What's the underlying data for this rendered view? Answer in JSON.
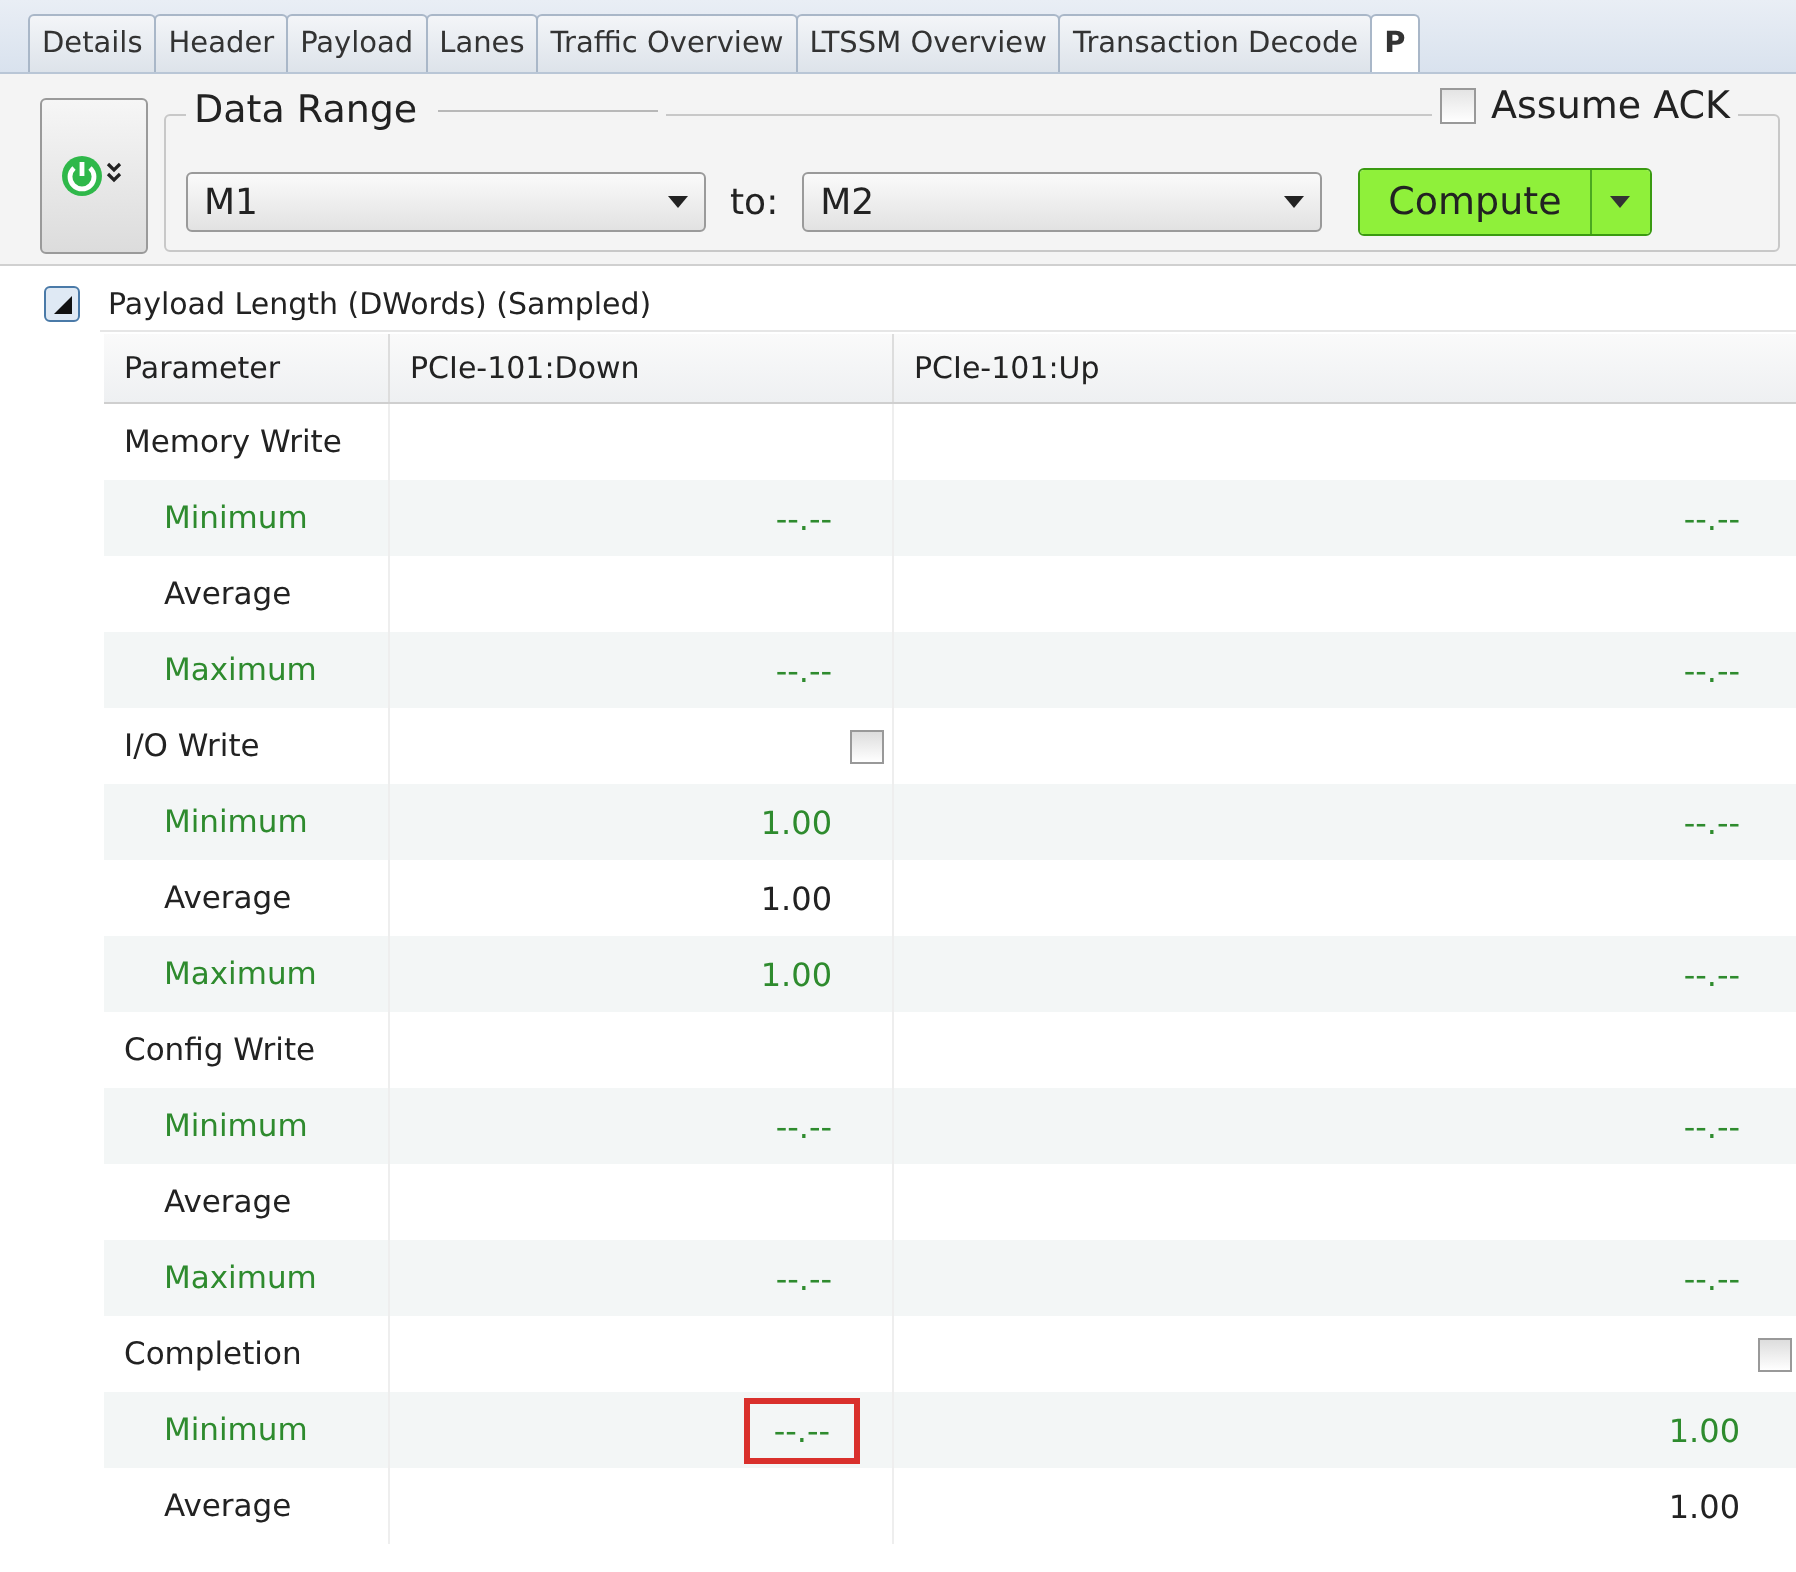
{
  "tabs": [
    {
      "label": "Details",
      "selected": false
    },
    {
      "label": "Header",
      "selected": false
    },
    {
      "label": "Payload",
      "selected": false
    },
    {
      "label": "Lanes",
      "selected": false
    },
    {
      "label": "Traffic Overview",
      "selected": false
    },
    {
      "label": "LTSSM Overview",
      "selected": false
    },
    {
      "label": "Transaction Decode",
      "selected": false
    },
    {
      "label": "P",
      "selected": true
    }
  ],
  "toolbar": {
    "data_range": {
      "title": "Data Range",
      "from": "M1",
      "to_label": "to:",
      "to": "M2"
    },
    "assume_ack": {
      "label": "Assume ACK",
      "checked": false
    },
    "compute_button": "Compute"
  },
  "section": {
    "title": "Payload Length (DWords) (Sampled)",
    "expanded": true
  },
  "table": {
    "columns": [
      "Parameter",
      "PCIe-101:Down",
      "PCIe-101:Up"
    ],
    "rows": [
      {
        "kind": "group",
        "label": "Memory Write",
        "cells": [
          {
            "kind": "empty"
          },
          {
            "kind": "empty"
          }
        ]
      },
      {
        "kind": "stat",
        "label": "Minimum",
        "accent": true,
        "cells": [
          {
            "kind": "text",
            "text": "--.--"
          },
          {
            "kind": "text",
            "text": "--.--"
          }
        ]
      },
      {
        "kind": "stat",
        "label": "Average",
        "accent": false,
        "cells": [
          {
            "kind": "empty"
          },
          {
            "kind": "empty"
          }
        ]
      },
      {
        "kind": "stat",
        "label": "Maximum",
        "accent": true,
        "cells": [
          {
            "kind": "text",
            "text": "--.--"
          },
          {
            "kind": "text",
            "text": "--.--"
          }
        ]
      },
      {
        "kind": "group",
        "label": "I/O Write",
        "cells": [
          {
            "kind": "checkbox",
            "checked": false
          },
          {
            "kind": "empty"
          }
        ]
      },
      {
        "kind": "stat",
        "label": "Minimum",
        "accent": true,
        "cells": [
          {
            "kind": "text",
            "text": "1.00"
          },
          {
            "kind": "text",
            "text": "--.--"
          }
        ]
      },
      {
        "kind": "stat",
        "label": "Average",
        "accent": false,
        "cells": [
          {
            "kind": "text",
            "text": "1.00"
          },
          {
            "kind": "empty"
          }
        ]
      },
      {
        "kind": "stat",
        "label": "Maximum",
        "accent": true,
        "cells": [
          {
            "kind": "text",
            "text": "1.00"
          },
          {
            "kind": "text",
            "text": "--.--"
          }
        ]
      },
      {
        "kind": "group",
        "label": "Config Write",
        "cells": [
          {
            "kind": "empty"
          },
          {
            "kind": "empty"
          }
        ]
      },
      {
        "kind": "stat",
        "label": "Minimum",
        "accent": true,
        "cells": [
          {
            "kind": "text",
            "text": "--.--"
          },
          {
            "kind": "text",
            "text": "--.--"
          }
        ]
      },
      {
        "kind": "stat",
        "label": "Average",
        "accent": false,
        "cells": [
          {
            "kind": "empty"
          },
          {
            "kind": "empty"
          }
        ]
      },
      {
        "kind": "stat",
        "label": "Maximum",
        "accent": true,
        "cells": [
          {
            "kind": "text",
            "text": "--.--"
          },
          {
            "kind": "text",
            "text": "--.--"
          }
        ]
      },
      {
        "kind": "group",
        "label": "Completion",
        "cells": [
          {
            "kind": "empty"
          },
          {
            "kind": "checkbox",
            "checked": false
          }
        ]
      },
      {
        "kind": "stat",
        "label": "Minimum",
        "accent": true,
        "cells": [
          {
            "kind": "text",
            "text": "--.--",
            "marked": true
          },
          {
            "kind": "text",
            "text": "1.00"
          }
        ]
      },
      {
        "kind": "stat",
        "label": "Average",
        "accent": false,
        "cells": [
          {
            "kind": "empty"
          },
          {
            "kind": "text",
            "text": "1.00"
          }
        ]
      }
    ]
  }
}
